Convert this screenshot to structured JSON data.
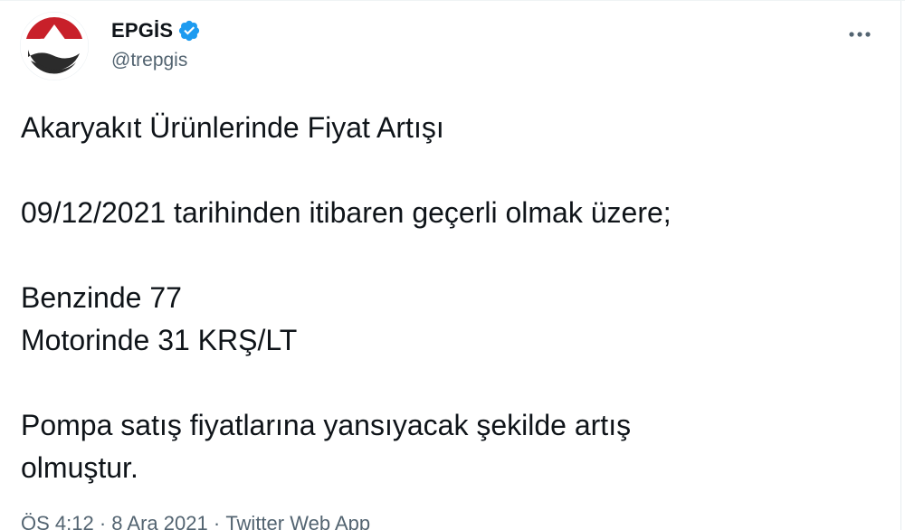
{
  "account": {
    "display_name": "EPGİS",
    "handle": "@trepgis",
    "verified": true,
    "avatar_icon": "epgis-logo"
  },
  "menu": {
    "icon": "more-horizontal-icon"
  },
  "tweet": {
    "title": "Akaryakıt Ürünlerinde Fiyat Artışı",
    "intro": "09/12/2021 tarihinden itibaren geçerli olmak üzere;",
    "line_gasoline": "Benzinde 77",
    "line_diesel": "Motorinde 31 KRŞ/LT",
    "closing_1": "Pompa satış fiyatlarına yansıyacak şekilde artış",
    "closing_2": "olmuştur."
  },
  "meta": {
    "time": "ÖS 4:12",
    "separator": "·",
    "date": "8 Ara 2021",
    "source": "Twitter Web App"
  },
  "colors": {
    "text": "#0f1419",
    "secondary": "#536471",
    "verified": "#1d9bf0",
    "logo_red": "#c8202a",
    "logo_dark": "#2b2b2b"
  }
}
